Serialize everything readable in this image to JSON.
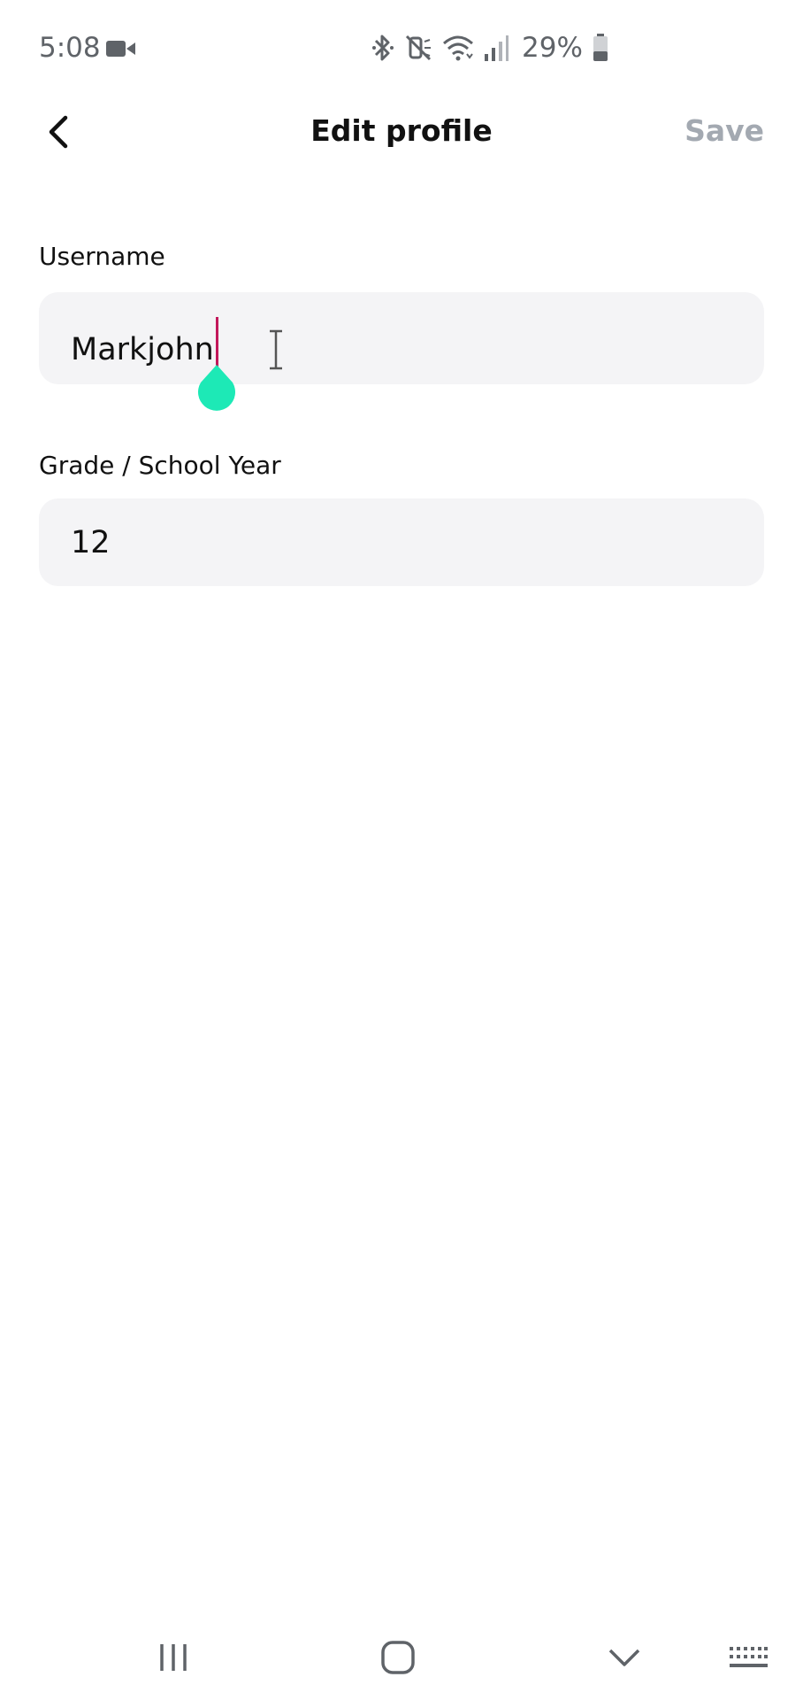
{
  "status_bar": {
    "time": "5:08",
    "battery_percent": "29%",
    "icons": [
      "video-recording-icon",
      "bluetooth-icon",
      "mute-icon",
      "wifi-icon",
      "signal-icon",
      "battery-icon"
    ]
  },
  "header": {
    "title": "Edit profile",
    "save_label": "Save",
    "back_icon": "chevron-left-icon"
  },
  "form": {
    "username": {
      "label": "Username",
      "value": "Markjohn"
    },
    "grade": {
      "label": "Grade / School Year",
      "value": "12"
    }
  },
  "nav_bar": {
    "icons": [
      "recents-icon",
      "home-icon",
      "hide-keyboard-icon",
      "keyboard-icon"
    ]
  },
  "colors": {
    "title": "#111111",
    "save_disabled": "#a3a9b1",
    "field_background": "#f4f4f6",
    "text_cursor": "#c2185b",
    "cursor_handle": "#1de9b6",
    "status_text": "#5f6368"
  }
}
